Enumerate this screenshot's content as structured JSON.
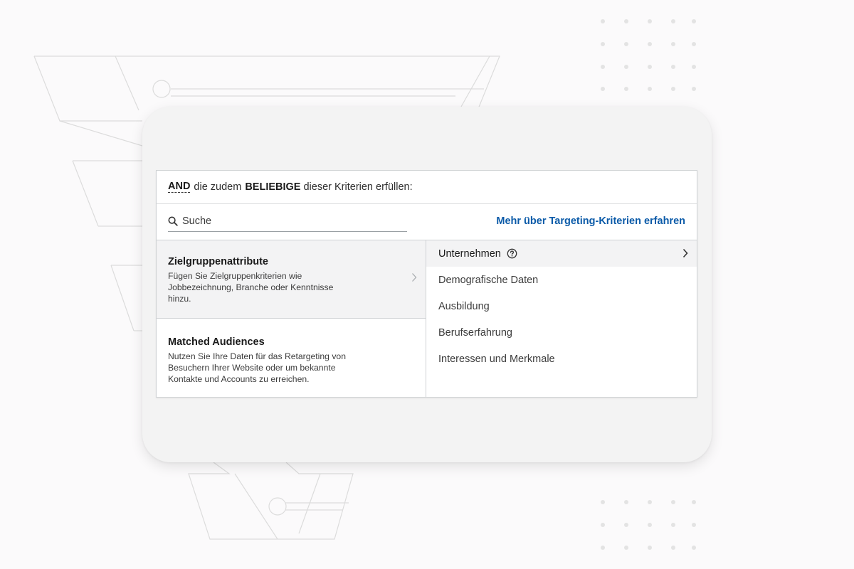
{
  "header": {
    "and": "AND",
    "text_1": "die zudem",
    "emphasis": "BELIEBIGE",
    "text_2": "dieser Kriterien erfüllen:"
  },
  "search": {
    "placeholder": "Suche",
    "icon": "search-icon"
  },
  "learn_more_link": "Mehr über Targeting-Kriterien erfahren",
  "categories": [
    {
      "title": "Zielgruppenattribute",
      "description": "Fügen Sie Zielgruppenkriterien wie Jobbezeichnung, Branche oder Kenntnisse hinzu."
    },
    {
      "title": "Matched Audiences",
      "description": "Nutzen Sie Ihre Daten für das Retargeting von Besuchern Ihrer Website oder um bekannte Kontakte und Accounts zu erreichen."
    }
  ],
  "options": [
    {
      "label": "Unternehmen"
    },
    {
      "label": "Demografische Daten"
    },
    {
      "label": "Ausbildung"
    },
    {
      "label": "Berufserfahrung"
    },
    {
      "label": "Interessen und Merkmale"
    }
  ],
  "colors": {
    "link": "#0a5aa8",
    "active_row": "#f3f3f4",
    "card": "#f3f3f3",
    "background": "#fbfafb"
  }
}
